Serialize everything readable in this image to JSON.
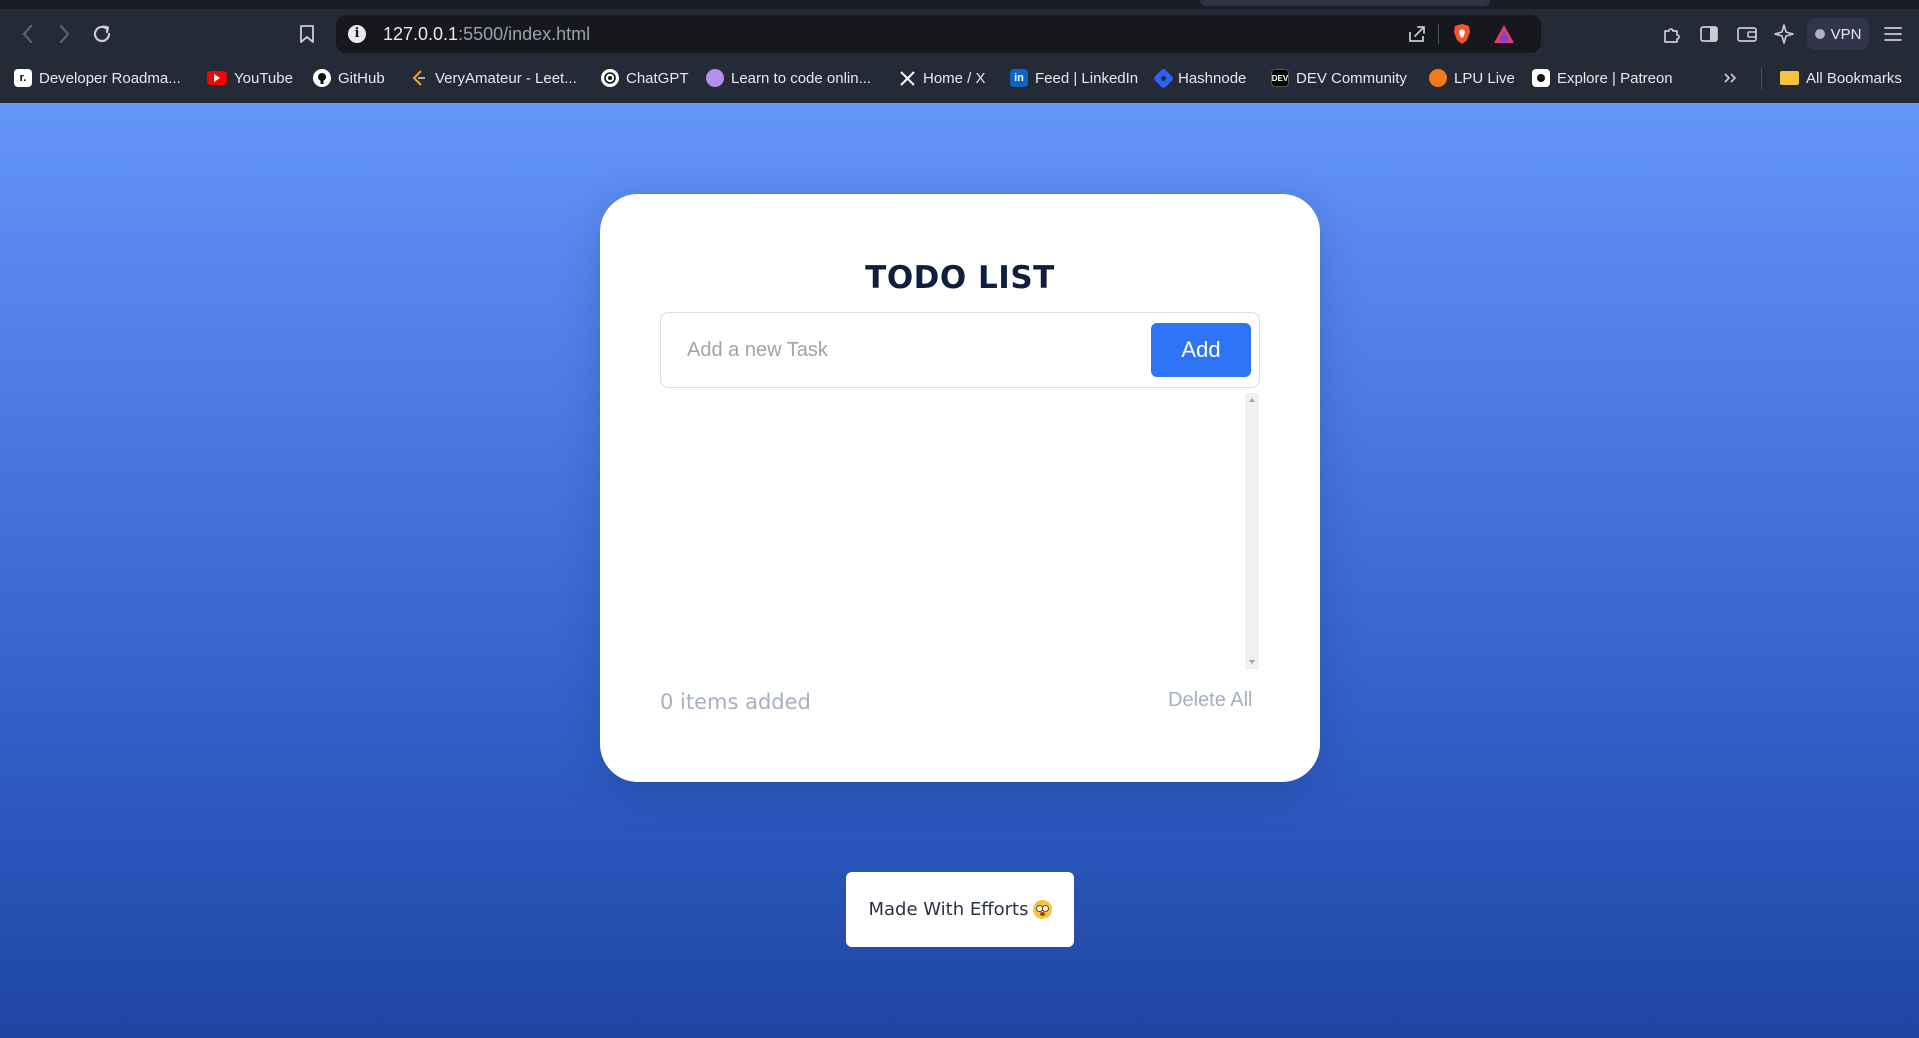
{
  "browser": {
    "url_host": "127.0.0.1",
    "url_path": ":5500/index.html",
    "vpn_label": "VPN",
    "bookmarks": [
      {
        "label": "Developer Roadma...",
        "icon": "roadmap-icon",
        "color": "#000000"
      },
      {
        "label": "YouTube",
        "icon": "youtube-icon",
        "color": "#ff0000"
      },
      {
        "label": "GitHub",
        "icon": "github-icon",
        "color": "#ffffff"
      },
      {
        "label": "VeryAmateur - Leet...",
        "icon": "leetcode-icon",
        "color": "#f0a330"
      },
      {
        "label": "ChatGPT",
        "icon": "chatgpt-icon",
        "color": "#ffffff"
      },
      {
        "label": "Learn to code onlin...",
        "icon": "freecodecamp-icon",
        "color": "#b48ef0"
      },
      {
        "label": "Home / X",
        "icon": "x-icon",
        "color": "#ffffff"
      },
      {
        "label": "Feed | LinkedIn",
        "icon": "linkedin-icon",
        "color": "#0a66c2"
      },
      {
        "label": "Hashnode",
        "icon": "hashnode-icon",
        "color": "#2962ff"
      },
      {
        "label": "DEV Community",
        "icon": "dev-icon",
        "color": "#000000"
      },
      {
        "label": "LPU Live",
        "icon": "lpu-icon",
        "color": "#f27a1a"
      },
      {
        "label": "Explore | Patreon",
        "icon": "patreon-icon",
        "color": "#ffffff"
      }
    ],
    "all_bookmarks_label": "All Bookmarks"
  },
  "app": {
    "title": "TODO LIST",
    "input_placeholder": "Add a new Task",
    "add_label": "Add",
    "count_text": "0 items added",
    "delete_all_label": "Delete All",
    "footer_text": "Made With Efforts",
    "accent": "#2f73f6"
  }
}
